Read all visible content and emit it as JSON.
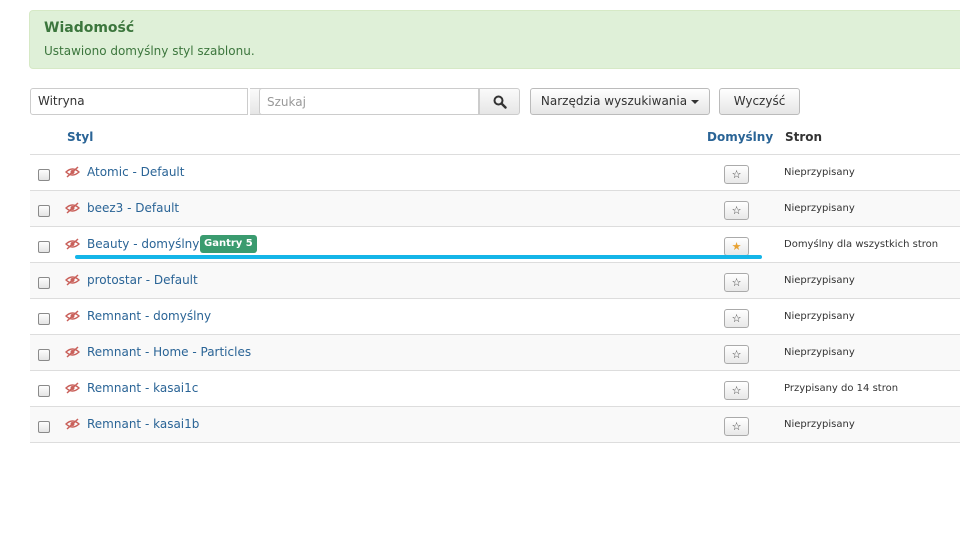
{
  "message": {
    "heading": "Wiadomość",
    "body": "Ustawiono domyślny styl szablonu."
  },
  "filters": {
    "client_select": "Witryna",
    "search_placeholder": "Szukaj",
    "search_tools_label": "Narzędzia wyszukiwania",
    "clear_label": "Wyczyść"
  },
  "table": {
    "columns": {
      "style": "Styl",
      "default": "Domyślny",
      "pages": "Stron"
    },
    "rows": [
      {
        "title": "Atomic - Default",
        "badge": "",
        "is_default": false,
        "status": "Nieprzypisany"
      },
      {
        "title": "beez3 - Default",
        "badge": "",
        "is_default": false,
        "status": "Nieprzypisany"
      },
      {
        "title": "Beauty - domyślny",
        "badge": "Gantry 5",
        "is_default": true,
        "status": "Domyślny dla wszystkich stron"
      },
      {
        "title": "protostar - Default",
        "badge": "",
        "is_default": false,
        "status": "Nieprzypisany"
      },
      {
        "title": "Remnant - domyślny",
        "badge": "",
        "is_default": false,
        "status": "Nieprzypisany"
      },
      {
        "title": "Remnant - Home - Particles",
        "badge": "",
        "is_default": false,
        "status": "Nieprzypisany"
      },
      {
        "title": "Remnant - kasai1c",
        "badge": "",
        "is_default": false,
        "status": "Przypisany do 14 stron"
      },
      {
        "title": "Remnant - kasai1b",
        "badge": "",
        "is_default": false,
        "status": "Nieprzypisany"
      }
    ]
  },
  "icons": {
    "row_preview": "eye-slash-icon",
    "search": "search-icon",
    "default_marker": "star-icon"
  },
  "colors": {
    "alert_background": "#dff0d8",
    "alert_text": "#3c763d",
    "link": "#2a6496",
    "badge": "#3a9b6f",
    "active_star": "#e8a232",
    "annotation_line": "#14b5e8"
  }
}
